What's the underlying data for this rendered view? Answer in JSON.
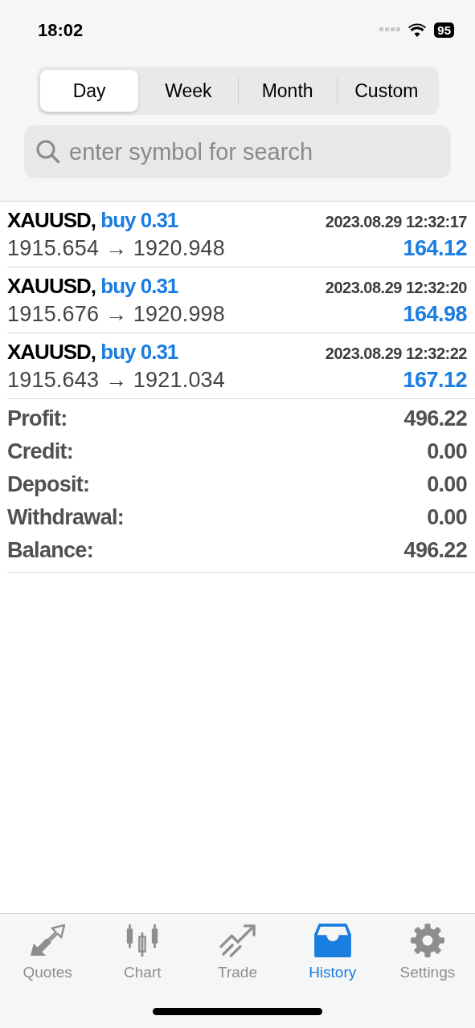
{
  "status_bar": {
    "time": "18:02",
    "battery": "95"
  },
  "period_tabs": [
    {
      "label": "Day",
      "selected": true
    },
    {
      "label": "Week",
      "selected": false
    },
    {
      "label": "Month",
      "selected": false
    },
    {
      "label": "Custom",
      "selected": false
    }
  ],
  "search": {
    "placeholder": "enter symbol for search"
  },
  "deals": [
    {
      "symbol": "XAUUSD,",
      "deal": "buy 0.31",
      "time": "2023.08.29 12:32:17",
      "open_price": "1915.654",
      "arrow": "→",
      "close_price": "1920.948",
      "profit": "164.12"
    },
    {
      "symbol": "XAUUSD,",
      "deal": "buy 0.31",
      "time": "2023.08.29 12:32:20",
      "open_price": "1915.676",
      "arrow": "→",
      "close_price": "1920.998",
      "profit": "164.98"
    },
    {
      "symbol": "XAUUSD,",
      "deal": "buy 0.31",
      "time": "2023.08.29 12:32:22",
      "open_price": "1915.643",
      "arrow": "→",
      "close_price": "1921.034",
      "profit": "167.12"
    }
  ],
  "summary": [
    {
      "label": "Profit:",
      "value": "496.22"
    },
    {
      "label": "Credit:",
      "value": "0.00"
    },
    {
      "label": "Deposit:",
      "value": "0.00"
    },
    {
      "label": "Withdrawal:",
      "value": "0.00"
    },
    {
      "label": "Balance:",
      "value": "496.22"
    }
  ],
  "tab_bar": [
    {
      "kind": "quotes",
      "label": "Quotes",
      "selected": false
    },
    {
      "kind": "chart",
      "label": "Chart",
      "selected": false
    },
    {
      "kind": "trade",
      "label": "Trade",
      "selected": false
    },
    {
      "kind": "history",
      "label": "History",
      "selected": true
    },
    {
      "kind": "settings",
      "label": "Settings",
      "selected": false
    }
  ]
}
